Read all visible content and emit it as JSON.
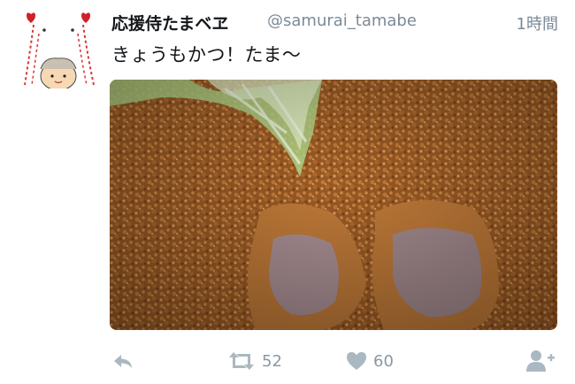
{
  "tweet": {
    "display_name": "応援侍たまベヱ",
    "handle": "@samurai_tamabe",
    "time": "1時間",
    "text": "きょうもかつ！たま〜"
  },
  "media": {
    "icon": "photo-fried-pork-cutlet"
  },
  "actions": {
    "reply": {
      "icon": "reply-icon"
    },
    "retweet": {
      "icon": "retweet-icon",
      "count": "52"
    },
    "like": {
      "icon": "heart-icon",
      "count": "60"
    },
    "follow": {
      "icon": "follow-icon"
    }
  },
  "colors": {
    "text": "#14171a",
    "secondary": "#7b8a97",
    "icon": "#aab8c2"
  }
}
